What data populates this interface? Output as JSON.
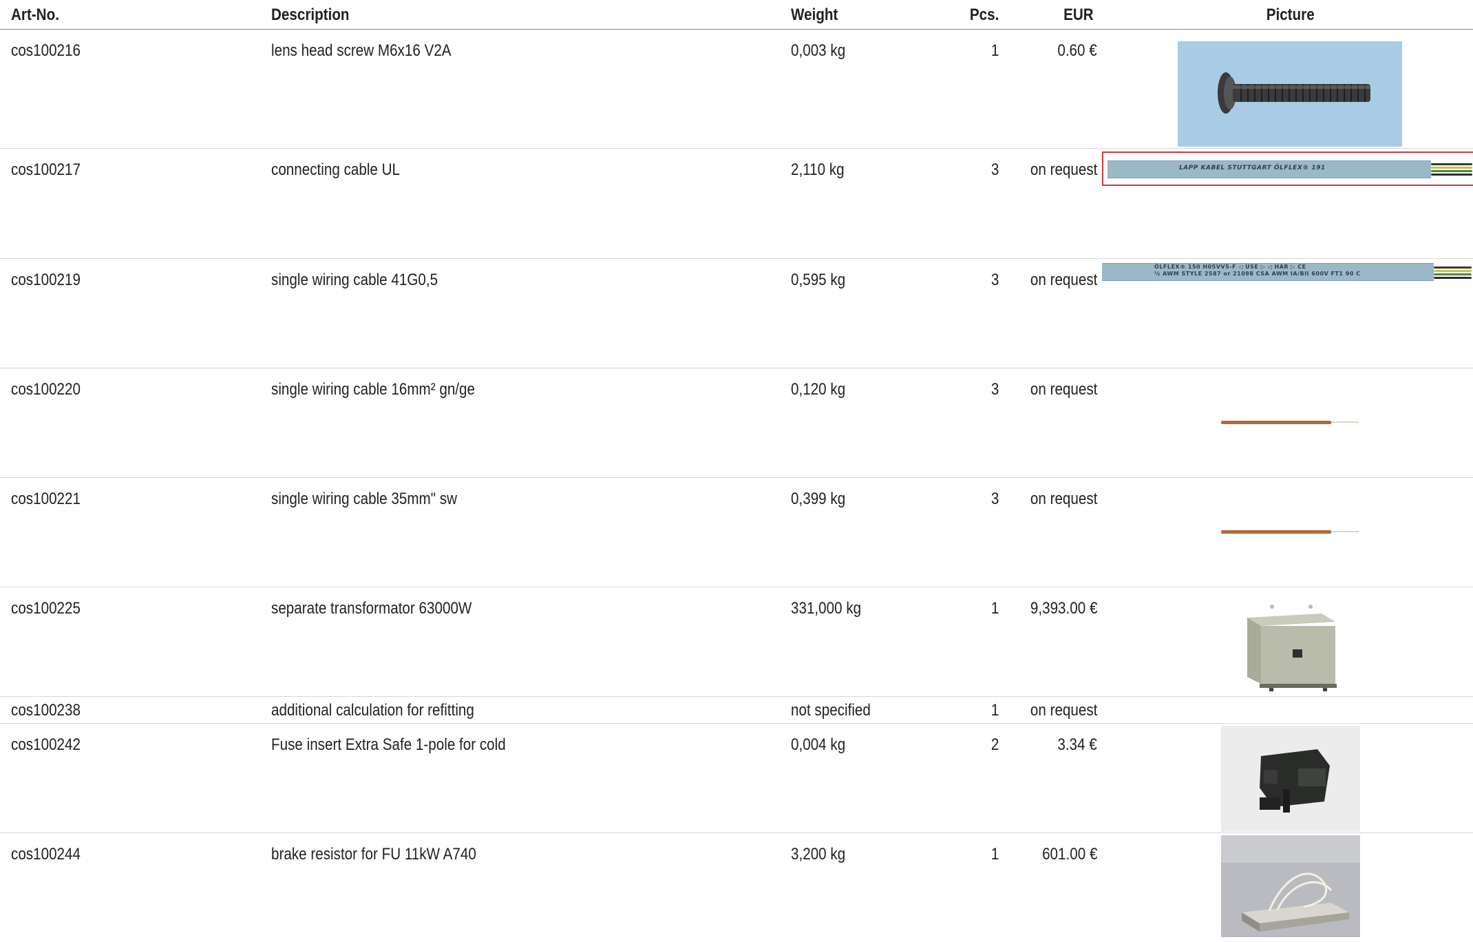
{
  "columns": {
    "art_no": "Art-No.",
    "description": "Description",
    "weight": "Weight",
    "pcs": "Pcs.",
    "eur": "EUR",
    "picture": "Picture"
  },
  "rows": [
    {
      "art_no": "cos100216",
      "description": "lens head screw M6x16 V2A",
      "weight": "0,003 kg",
      "pcs": "1",
      "eur": "0.60 €",
      "picture": "screw-photo"
    },
    {
      "art_no": "cos100217",
      "description": "connecting cable UL",
      "weight": "2,110 kg",
      "pcs": "3",
      "eur": "on request",
      "picture": "cable-photo",
      "picture_text": "LAPP KABEL  STUTTGART  ÖLFLEX® 191"
    },
    {
      "art_no": "cos100219",
      "description": "single wiring cable 41G0,5",
      "weight": "0,595 kg",
      "pcs": "3",
      "eur": "on request",
      "picture": "cable-photo",
      "picture_text": "ÖLFLEX® 150 H05VV5-F  ◁ USE ▷  ◁ HAR ▷   CE",
      "picture_text_2": "½ AWM STYLE 2587 or 21098 CSA AWM IA/BII 600V FT1 90 C"
    },
    {
      "art_no": "cos100220",
      "description": "single wiring cable 16mm² gn/ge",
      "weight": "0,120 kg",
      "pcs": "3",
      "eur": "on request",
      "picture": "wire-photo"
    },
    {
      "art_no": "cos100221",
      "description": "single wiring cable 35mm\" sw",
      "weight": "0,399 kg",
      "pcs": "3",
      "eur": "on request",
      "picture": "wire-photo"
    },
    {
      "art_no": "cos100225",
      "description": "separate transformator 63000W",
      "weight": "331,000 kg",
      "pcs": "1",
      "eur": "9,393.00 €",
      "picture": "transformer-photo"
    },
    {
      "art_no": "cos100238",
      "description": "additional calculation for refitting",
      "weight": "not specified",
      "pcs": "1",
      "eur": "on request",
      "picture": "none"
    },
    {
      "art_no": "cos100242",
      "description": "Fuse insert Extra Safe 1-pole for cold",
      "weight": "0,004 kg",
      "pcs": "2",
      "eur": "3.34 €",
      "picture": "fuse-photo"
    },
    {
      "art_no": "cos100244",
      "description": "brake resistor for FU 11kW A740",
      "weight": "3,200 kg",
      "pcs": "1",
      "eur": "601.00 €",
      "picture": "resistor-photo"
    }
  ],
  "colors": {
    "header_rule": "#888888",
    "row_rule": "#d7d7d7",
    "screw_bg": "#a8cce6",
    "cable_grey": "#9bb8c9",
    "cable_frame": "#cc3b3b",
    "copper": "#b06a3a"
  }
}
